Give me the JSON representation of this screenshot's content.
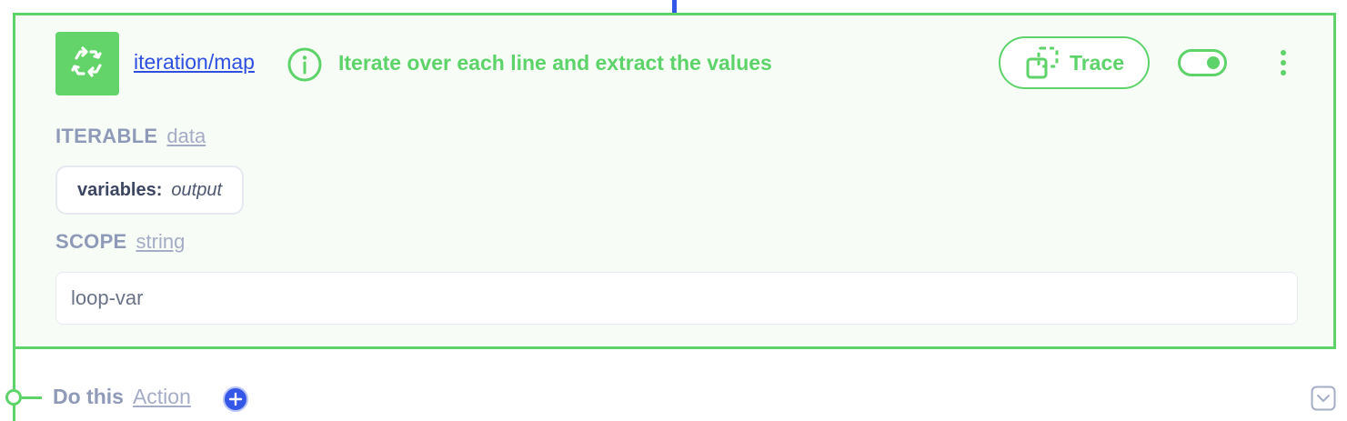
{
  "module": {
    "name": "iteration/map",
    "summary": "Iterate over each line and extract the values",
    "trace_label": "Trace",
    "icon": "recycle-icon",
    "enabled": true
  },
  "fields": {
    "iterable": {
      "label": "ITERABLE",
      "type": "data",
      "pill_key": "variables:",
      "pill_value": "output"
    },
    "scope": {
      "label": "SCOPE",
      "type": "string",
      "value": "loop-var"
    }
  },
  "next": {
    "label": "Do this",
    "type": "Action"
  },
  "colors": {
    "accent": "#5dd36a",
    "link": "#2f4fe0",
    "connector": "#3557e8",
    "muted": "#8f9ab8"
  }
}
